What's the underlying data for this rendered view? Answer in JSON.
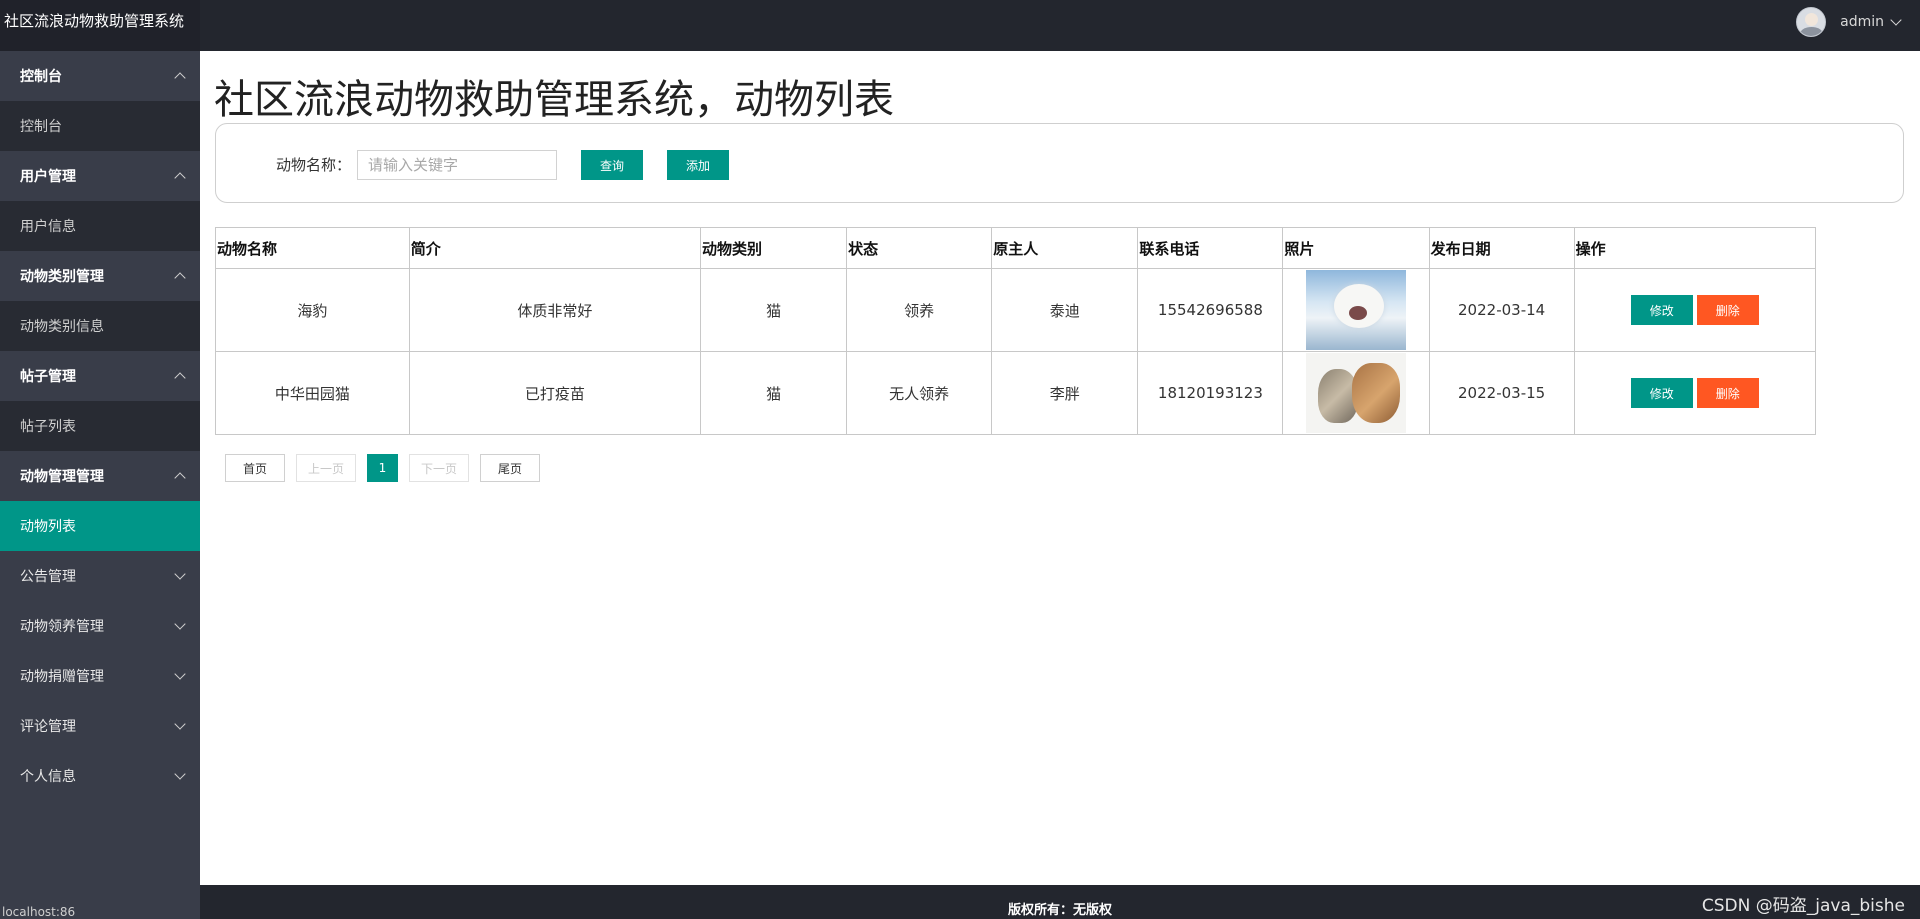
{
  "app": {
    "title": "社区流浪动物救助管理系统",
    "user": "admin",
    "status_url": "localhost:86"
  },
  "sidebar": {
    "groups": [
      {
        "label": "控制台",
        "expanded": true,
        "items": [
          "控制台"
        ]
      },
      {
        "label": "用户管理",
        "expanded": true,
        "items": [
          "用户信息"
        ]
      },
      {
        "label": "动物类别管理",
        "expanded": true,
        "items": [
          "动物类别信息"
        ]
      },
      {
        "label": "帖子管理",
        "expanded": true,
        "items": [
          "帖子列表"
        ]
      },
      {
        "label": "动物管理管理",
        "expanded": true,
        "items": [
          "动物列表"
        ]
      },
      {
        "label": "公告管理",
        "expanded": false,
        "items": []
      },
      {
        "label": "动物领养管理",
        "expanded": false,
        "items": []
      },
      {
        "label": "动物捐赠管理",
        "expanded": false,
        "items": []
      },
      {
        "label": "评论管理",
        "expanded": false,
        "items": []
      },
      {
        "label": "个人信息",
        "expanded": false,
        "items": []
      }
    ],
    "active_item": "动物列表"
  },
  "main": {
    "page_title": "社区流浪动物救助管理系统，动物列表",
    "search": {
      "label": "动物名称：",
      "value": "",
      "placeholder": "请输入关键字",
      "query_label": "查询",
      "add_label": "添加"
    },
    "table": {
      "columns": [
        "动物名称",
        "简介",
        "动物类别",
        "状态",
        "原主人",
        "联系电话",
        "照片",
        "发布日期",
        "操作"
      ],
      "rows": [
        {
          "name": "海豹",
          "intro": "体质非常好",
          "category": "猫",
          "status": "领养",
          "owner": "泰迪",
          "phone": "15542696588",
          "photo": "seal-photo",
          "date": "2022-03-14"
        },
        {
          "name": "中华田园猫",
          "intro": "已打疫苗",
          "category": "猫",
          "status": "无人领养",
          "owner": "李胖",
          "phone": "18120193123",
          "photo": "cat-rabbit-photo",
          "date": "2022-03-15"
        }
      ],
      "edit_label": "修改",
      "delete_label": "删除"
    },
    "pager": {
      "first": "首页",
      "prev": "上一页",
      "current_page": "1",
      "next": "下一页",
      "last": "尾页"
    }
  },
  "footer": {
    "copyright": "版权所有：无版权",
    "watermark": "CSDN @码盗_java_bishe"
  },
  "colors": {
    "primary": "#009688",
    "danger": "#ff5722",
    "sidebar": "#393d49",
    "topbar": "#23262e"
  }
}
